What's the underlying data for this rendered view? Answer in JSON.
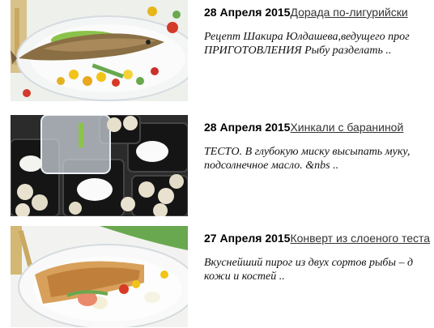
{
  "articles": [
    {
      "date": "28 Апреля 2015",
      "title": "Дорада по-лигурийски",
      "excerpt": "Рецепт Шакира Юлдашева,ведущего прог\nПРИГОТОВЛЕНИЯ Рыбу разделать ..",
      "image": "fish-dish-image"
    },
    {
      "date": "28 Апреля 2015",
      "title": "Хинкали с бараниной",
      "excerpt": "ТЕСТО. В глубокую миску высыпать муку,\nподсолнечное масло. &nbs ..",
      "image": "khinkali-containers-image"
    },
    {
      "date": "27 Апреля 2015",
      "title": "Конверт из слоеного теста",
      "excerpt": "Вкуснейший пирог из двух сортов рыбы – д\nкожи и костей ..",
      "image": "pastry-envelope-image"
    }
  ]
}
